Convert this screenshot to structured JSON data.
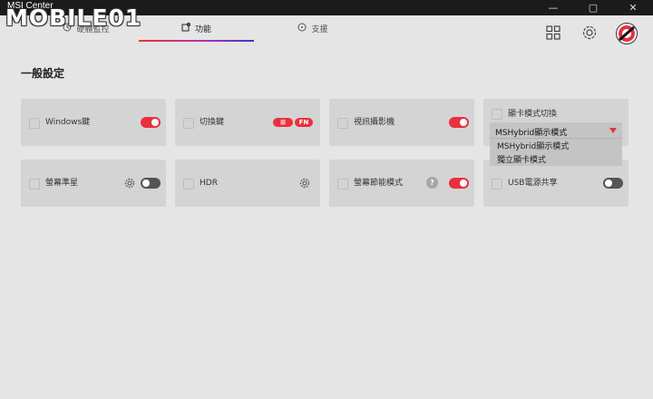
{
  "window": {
    "title": "MSI Center",
    "minimize_glyph": "—",
    "maximize_glyph": "▢",
    "close_glyph": "✕"
  },
  "watermark": {
    "text": "MOBILE01"
  },
  "tabs": [
    {
      "label": "硬體監控",
      "icon": "monitor-icon"
    },
    {
      "label": "功能",
      "icon": "feature-icon",
      "active": true
    },
    {
      "label": "支援",
      "icon": "support-icon"
    }
  ],
  "header": {
    "icons": [
      "grid-icon",
      "settings-icon",
      "avatar"
    ]
  },
  "section": {
    "title": "一般設定"
  },
  "cards": {
    "windows_key": {
      "label": "Windows鍵",
      "toggle": true
    },
    "switch_key": {
      "label": "切換鍵",
      "pill_win": "⊞",
      "pill_fn": "FN"
    },
    "webcam": {
      "label": "視訊攝影機",
      "toggle": true
    },
    "gpu_mode": {
      "label": "顯卡模式切換",
      "selected": "MSHybrid顯示模式",
      "options": [
        "MSHybrid顯示模式",
        "獨立顯卡模式"
      ]
    },
    "crosshair": {
      "label": "螢幕準星",
      "toggle": false
    },
    "hdr": {
      "label": "HDR"
    },
    "eco_display": {
      "label": "螢幕節能模式",
      "help": "?",
      "toggle": true
    },
    "usb_power": {
      "label": "USB電源共享",
      "toggle": false
    }
  },
  "colors": {
    "accent": "#e8303f",
    "background": "#e5e5e5",
    "card": "#d4d4d4",
    "titlebar": "#1b1b1b"
  }
}
